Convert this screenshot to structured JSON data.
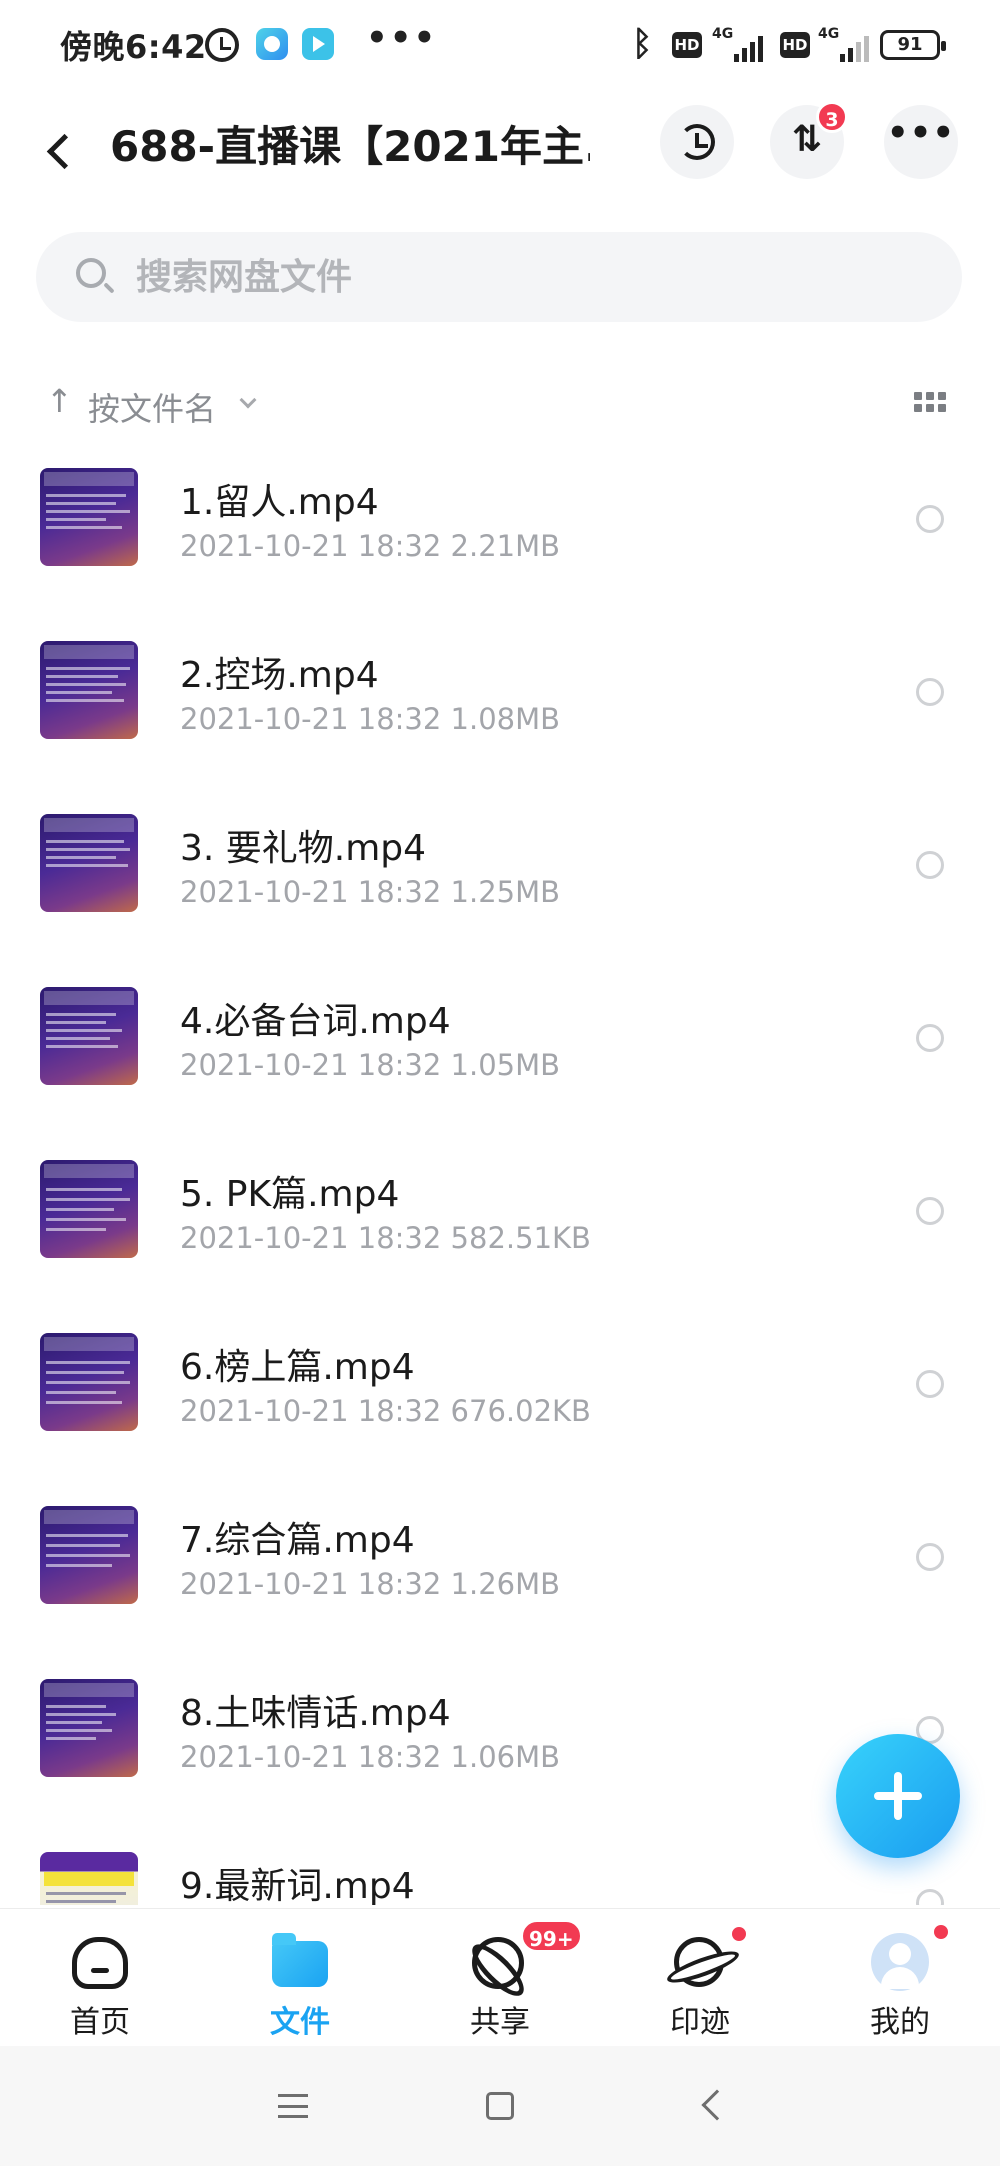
{
  "status_bar": {
    "time": "傍晚6:42",
    "more": "•••",
    "hd_badges": [
      "HD",
      "HD"
    ],
    "network_tags": [
      "4G",
      "4G"
    ],
    "battery": "91"
  },
  "header": {
    "title": "688-直播课【2021年主...",
    "transfer_glyph": "⇅",
    "transfer_badge": "3",
    "more_glyph": "•••"
  },
  "search": {
    "placeholder": "搜索网盘文件"
  },
  "sort": {
    "arrow": "↑",
    "label": "按文件名"
  },
  "files": [
    {
      "name": "1.留人.mp4",
      "meta": "2021-10-21   18:32   2.21MB"
    },
    {
      "name": "2.控场.mp4",
      "meta": "2021-10-21   18:32   1.08MB"
    },
    {
      "name": "3. 要礼物.mp4",
      "meta": "2021-10-21   18:32   1.25MB"
    },
    {
      "name": "4.必备台词.mp4",
      "meta": "2021-10-21   18:32   1.05MB"
    },
    {
      "name": "5. PK篇.mp4",
      "meta": "2021-10-21   18:32   582.51KB"
    },
    {
      "name": "6.榜上篇.mp4",
      "meta": "2021-10-21   18:32   676.02KB"
    },
    {
      "name": "7.综合篇.mp4",
      "meta": "2021-10-21   18:32   1.26MB"
    },
    {
      "name": "8.土味情话.mp4",
      "meta": "2021-10-21   18:32   1.06MB"
    },
    {
      "name": "9.最新词.mp4",
      "meta": ""
    }
  ],
  "bottom_nav": [
    {
      "label": "首页"
    },
    {
      "label": "文件"
    },
    {
      "label": "共享",
      "badge": "99+"
    },
    {
      "label": "印迹"
    },
    {
      "label": "我的"
    }
  ],
  "colors": {
    "accent": "#1aa3f2",
    "badge": "#f23a52"
  }
}
